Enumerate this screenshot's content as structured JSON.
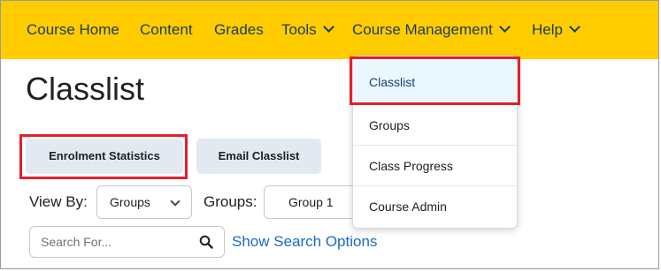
{
  "navbar": {
    "items": [
      {
        "label": "Course Home"
      },
      {
        "label": "Content"
      },
      {
        "label": "Grades"
      },
      {
        "label": "Tools"
      },
      {
        "label": "Course Management"
      },
      {
        "label": "Help"
      }
    ]
  },
  "page": {
    "title": "Classlist"
  },
  "actions": {
    "enrolment_statistics": "Enrolment Statistics",
    "email_classlist": "Email Classlist"
  },
  "filters": {
    "view_by_label": "View By:",
    "view_by_value": "Groups",
    "groups_label": "Groups:",
    "groups_value": "Group 1"
  },
  "search": {
    "placeholder": "Search For...",
    "show_options": "Show Search Options"
  },
  "dropdown": {
    "items": [
      {
        "label": "Classlist"
      },
      {
        "label": "Groups"
      },
      {
        "label": "Class Progress"
      },
      {
        "label": "Course Admin"
      }
    ]
  },
  "colors": {
    "navbar": "#ffcc00",
    "highlight": "#e51f2b",
    "link": "#1a6ac6",
    "button": "#e3e9f1",
    "active_item": "#eaf7fe"
  }
}
